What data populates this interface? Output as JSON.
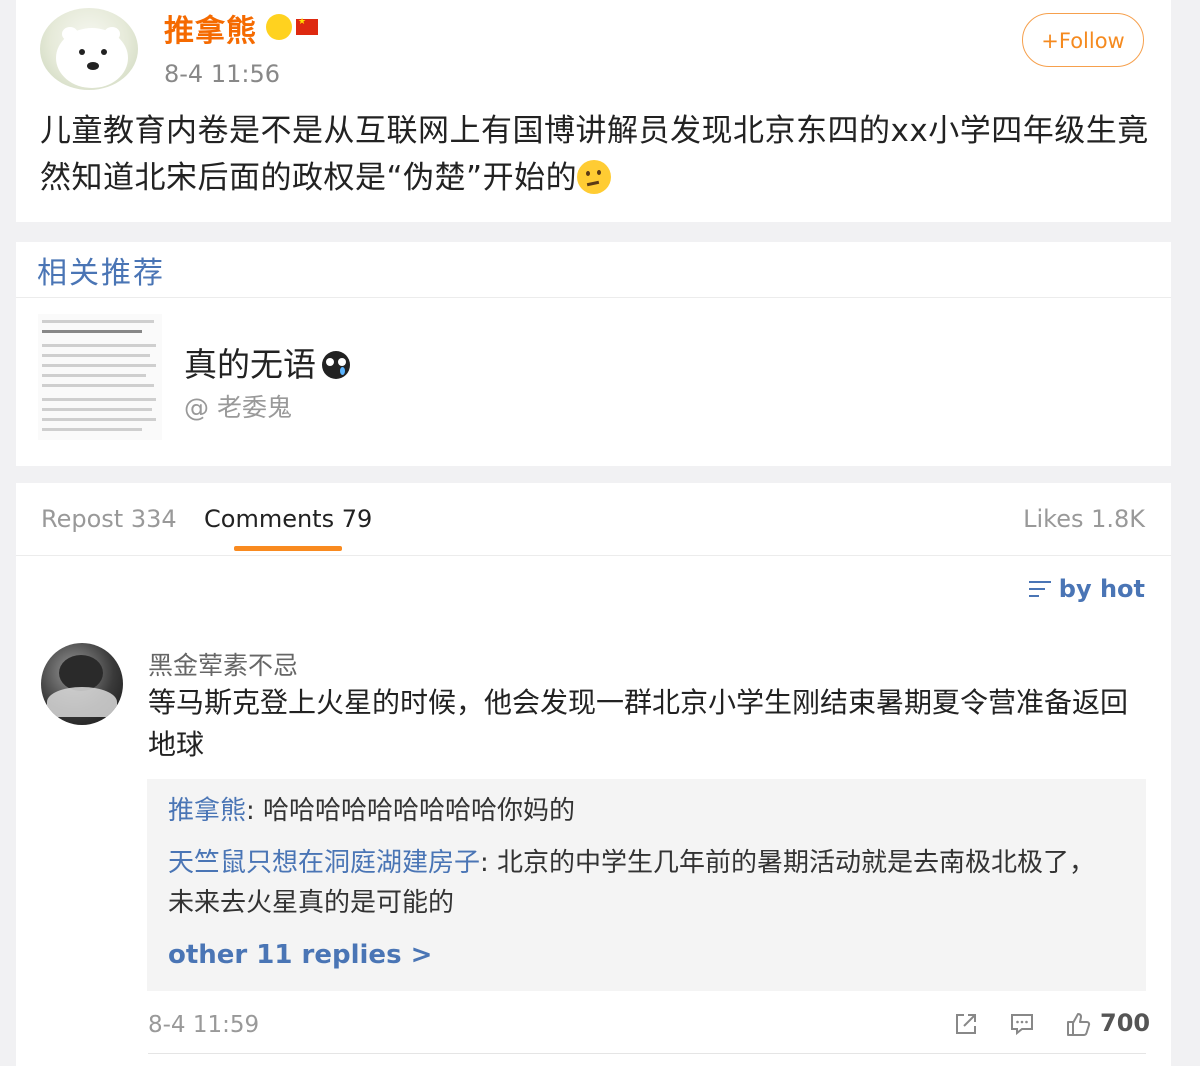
{
  "post": {
    "username": "推拿熊",
    "time": "8-4 11:56",
    "follow_label": "+Follow",
    "text": "儿童教育内卷是不是从互联网上有国博讲解员发现北京东四的xx小学四年级生竟然知道北宋后面的政权是“伪楚”开始的"
  },
  "recommend": {
    "section_title": "相关推荐",
    "item_title": "真的无语",
    "item_author": "@ 老委鬼"
  },
  "tabs": {
    "repost": "Repost 334",
    "comments": "Comments 79",
    "likes": "Likes 1.8K"
  },
  "sort_label": "by hot",
  "comment": {
    "username": "黑金荤素不忌",
    "text": "等马斯克登上火星的时候，他会发现一群北京小学生刚结束暑期夏令营准备返回地球",
    "time": "8-4 11:59",
    "like_count": "700",
    "replies": [
      {
        "name": "推拿熊",
        "text": ": 哈哈哈哈哈哈哈哈哈你妈的"
      },
      {
        "name": "天竺鼠只想在洞庭湖建房子",
        "text": ": 北京的中学生几年前的暑期活动就是去南极北极了，未来去火星真的是可能的"
      }
    ],
    "more_replies": "other 11 replies >"
  },
  "colors": {
    "accent_orange": "#f58a1f",
    "link_blue": "#4a75b5",
    "username_orange": "#f56a00"
  }
}
